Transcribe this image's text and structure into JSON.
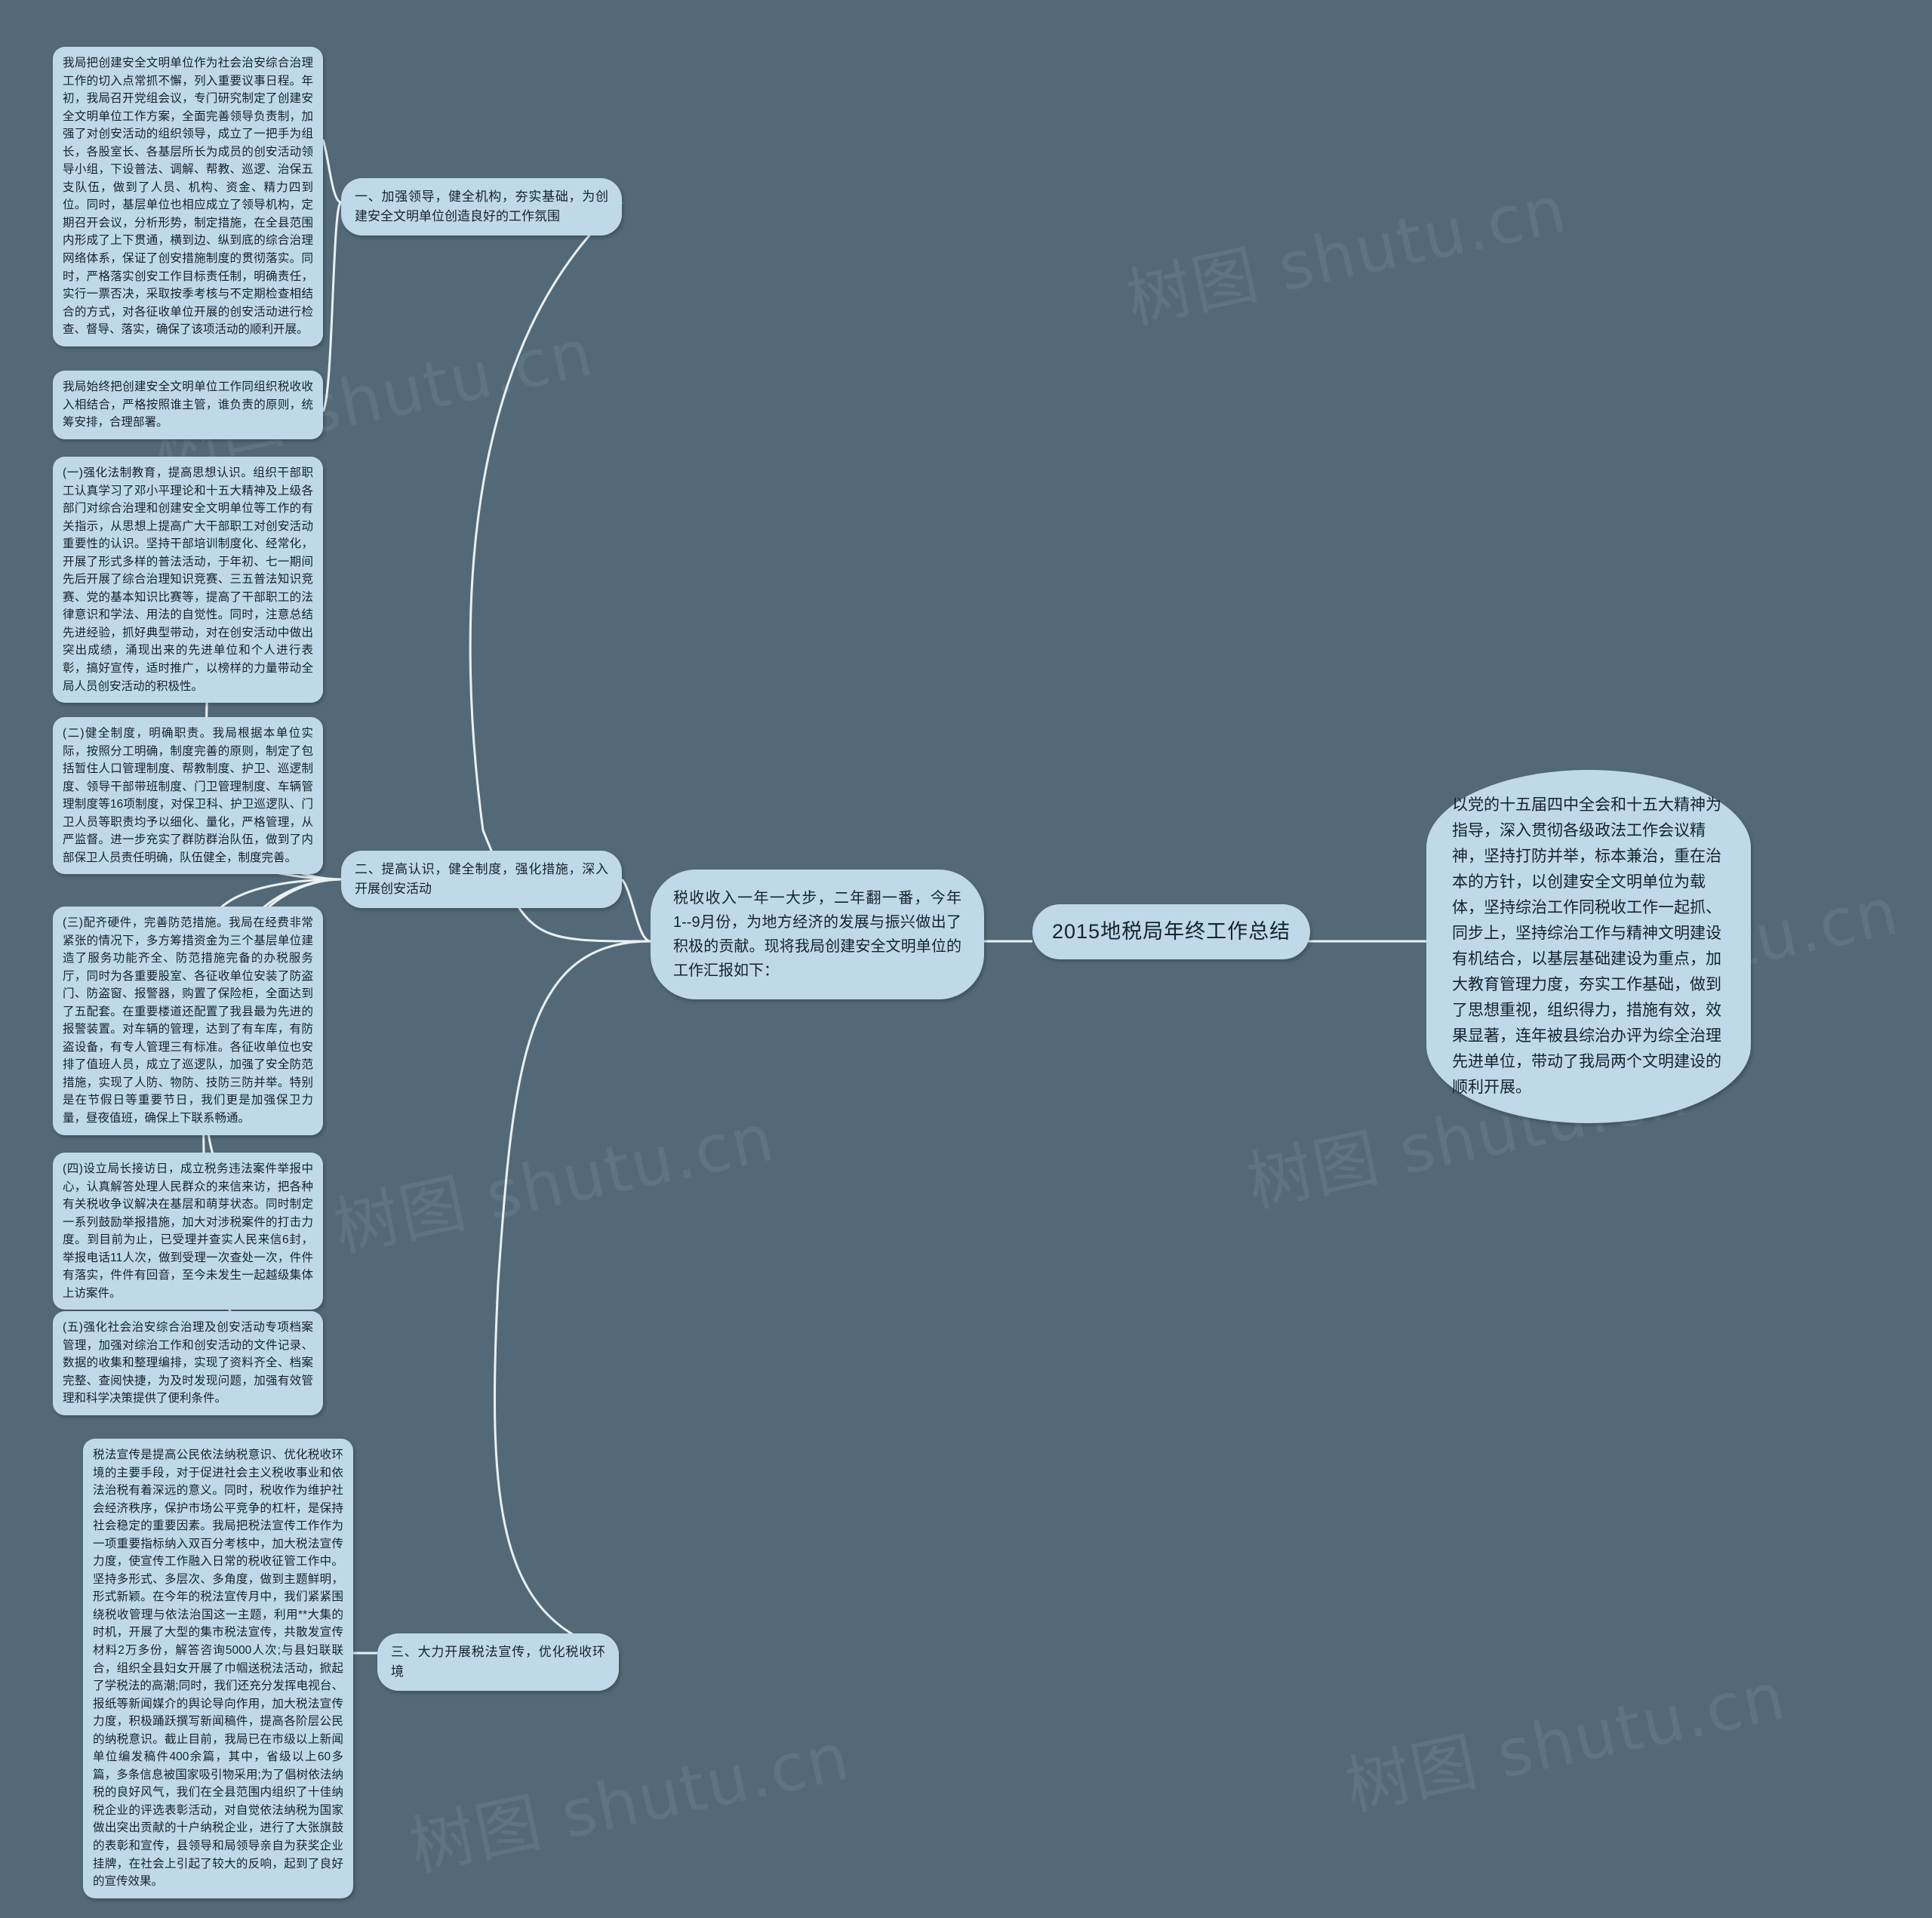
{
  "canvas": {
    "background": "#536977",
    "node_fill": "#bfd9e9",
    "node_text": "#16222b",
    "wire": "#e9f1f5"
  },
  "watermark": {
    "text": "树图 shutu.cn"
  },
  "root": {
    "label": "2015地税局年终工作总结"
  },
  "intro": {
    "text": "税收收入一年一大步，二年翻一番，今年 1--9月份，为地方经济的发展与振兴做出了积极的贡献。现将我局创建安全文明单位的工作汇报如下："
  },
  "summary": {
    "text": "以党的十五届四中全会和十五大精神为指导，深入贯彻各级政法工作会议精神，坚持打防并举，标本兼治，重在治本的方针，以创建安全文明单位为载体，坚持综治工作同税收工作一起抓、同步上，坚持综治工作与精神文明建设有机结合，以基层基础建设为重点，加大教育管理力度，夯实工作基础，做到了思想重视，组织得力，措施有效，效果显著，连年被县综治办评为综全治理先进单位，带动了我局两个文明建设的顺利开展。"
  },
  "branches": [
    {
      "label": "一、加强领导，健全机构，夯实基础，为创建安全文明单位创造良好的工作氛围"
    },
    {
      "label": "二、提高认识，健全制度，强化措施，深入开展创安活动"
    },
    {
      "label": "三、大力开展税法宣传，优化税收环境"
    }
  ],
  "leaves": [
    {
      "text": "我局把创建安全文明单位作为社会治安综合治理工作的切入点常抓不懈，列入重要议事日程。年初，我局召开党组会议，专门研究制定了创建安全文明单位工作方案，全面完善领导负责制，加强了对创安活动的组织领导，成立了一把手为组长，各股室长、各基层所长为成员的创安活动领导小组，下设普法、调解、帮教、巡逻、治保五支队伍，做到了人员、机构、资金、精力四到位。同时，基层单位也相应成立了领导机构，定期召开会议，分析形势，制定措施，在全县范围内形成了上下贯通，横到边、纵到底的综合治理网络体系，保证了创安措施制度的贯彻落实。同时，严格落实创安工作目标责任制，明确责任，实行一票否决，采取按季考核与不定期检查相结合的方式，对各征收单位开展的创安活动进行检查、督导、落实，确保了该项活动的顺利开展。"
    },
    {
      "text": "我局始终把创建安全文明单位工作同组织税收收入相结合，严格按照谁主管，谁负责的原则，统筹安排，合理部署。"
    },
    {
      "text": "(一)强化法制教育，提高思想认识。组织干部职工认真学习了邓小平理论和十五大精神及上级各部门对综合治理和创建安全文明单位等工作的有关指示，从思想上提高广大干部职工对创安活动重要性的认识。坚持干部培训制度化、经常化，开展了形式多样的普法活动，于年初、七一期间先后开展了综合治理知识竞赛、三五普法知识竞赛、党的基本知识比赛等，提高了干部职工的法律意识和学法、用法的自觉性。同时，注意总结先进经验，抓好典型带动，对在创安活动中做出突出成绩，涌现出来的先进单位和个人进行表彰，搞好宣传，适时推广，以榜样的力量带动全局人员创安活动的积极性。"
    },
    {
      "text": "(二)健全制度，明确职责。我局根据本单位实际，按照分工明确，制度完善的原则，制定了包括暂住人口管理制度、帮教制度、护卫、巡逻制度、领导干部带班制度、门卫管理制度、车辆管理制度等16项制度，对保卫科、护卫巡逻队、门卫人员等职责均予以细化、量化，严格管理，从严监督。进一步充实了群防群治队伍，做到了内部保卫人员责任明确，队伍健全，制度完善。"
    },
    {
      "text": "(三)配齐硬件，完善防范措施。我局在经费非常紧张的情况下，多方筹措资金为三个基层单位建造了服务功能齐全、防范措施完备的办税服务厅，同时为各重要股室、各征收单位安装了防盗门、防盗窗、报警器，购置了保险柜，全面达到了五配套。在重要楼道还配置了我县最为先进的报警装置。对车辆的管理，达到了有车库，有防盗设备，有专人管理三有标准。各征收单位也安排了值班人员，成立了巡逻队，加强了安全防范措施，实现了人防、物防、技防三防并举。特别是在节假日等重要节日，我们更是加强保卫力量，昼夜值班，确保上下联系畅通。"
    },
    {
      "text": "(四)设立局长接访日，成立税务违法案件举报中心，认真解答处理人民群众的来信来访，把各种有关税收争议解决在基层和萌芽状态。同时制定一系列鼓励举报措施，加大对涉税案件的打击力度。到目前为止，已受理并查实人民来信6封，举报电话11人次，做到受理一次查处一次，件件有落实，件件有回音，至今未发生一起越级集体上访案件。"
    },
    {
      "text": "(五)强化社会治安综合治理及创安活动专项档案管理，加强对综治工作和创安活动的文件记录、数据的收集和整理编排，实现了资料齐全、档案完整、查阅快捷，为及时发现问题，加强有效管理和科学决策提供了便利条件。"
    },
    {
      "text": "税法宣传是提高公民依法纳税意识、优化税收环境的主要手段，对于促进社会主义税收事业和依法治税有着深远的意义。同时，税收作为维护社会经济秩序，保护市场公平竞争的杠杆，是保持社会稳定的重要因素。我局把税法宣传工作作为一项重要指标纳入双百分考核中，加大税法宣传力度，使宣传工作融入日常的税收征管工作中。坚持多形式、多层次、多角度，做到主题鲜明，形式新颖。在今年的税法宣传月中，我们紧紧围绕税收管理与依法治国这一主题，利用**大集的时机，开展了大型的集市税法宣传，共散发宣传材料2万多份，解答咨询5000人次;与县妇联联合，组织全县妇女开展了巾帼送税法活动，掀起了学税法的高潮;同时，我们还充分发挥电视台、报纸等新闻媒介的舆论导向作用，加大税法宣传力度，积极踊跃撰写新闻稿件，提高各阶层公民的纳税意识。截止目前，我局已在市级以上新闻单位编发稿件400余篇，其中，省级以上60多篇，多条信息被国家吸引物采用;为了倡树依法纳税的良好风气，我们在全县范围内组织了十佳纳税企业的评选表彰活动，对自觉依法纳税为国家做出突出贡献的十户纳税企业，进行了大张旗鼓的表彰和宣传，县领导和局领导亲自为获奖企业挂牌，在社会上引起了较大的反响，起到了良好的宣传效果。"
    }
  ]
}
